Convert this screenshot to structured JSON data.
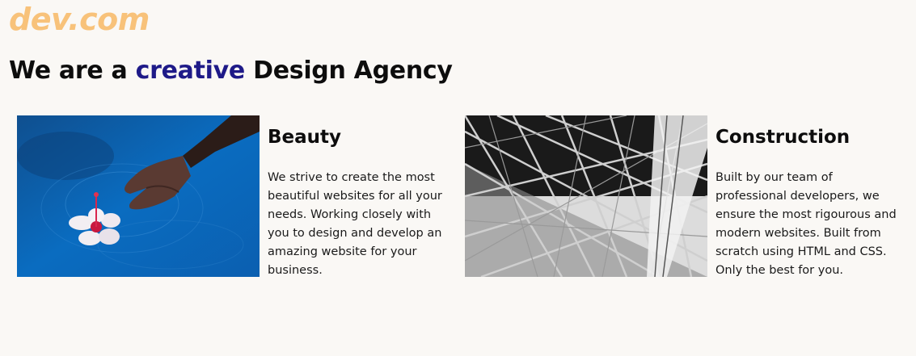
{
  "brand": {
    "logo_text": "dev.com"
  },
  "hero": {
    "prefix": "We are a",
    "accent": "creative",
    "suffix": "Design Agency"
  },
  "cards": [
    {
      "title": "Beauty",
      "description": "We strive to create the most beautiful websites for all your needs. Working closely with you to design and develop an amazing website for your business.",
      "image": "hand-in-water-with-flower"
    },
    {
      "title": "Construction",
      "description": "Built by our team of professional developers, we ensure the most rigourous and modern websites. Built from scratch using HTML and CSS. Only the best for you.",
      "image": "steel-structure-black-and-white"
    }
  ],
  "colors": {
    "background": "#faf8f5",
    "logo": "#f8c27a",
    "accent": "#1e1a88",
    "text": "#0d0d0d"
  }
}
